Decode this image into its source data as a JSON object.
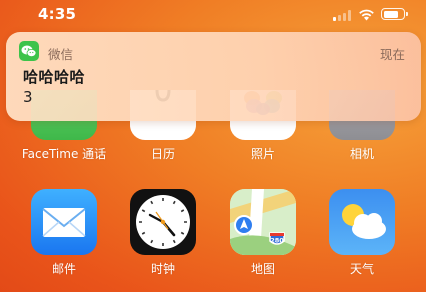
{
  "status_bar": {
    "time": "4:35",
    "signal_icon": "cellular-signal-icon",
    "wifi_icon": "wifi-icon",
    "battery_icon": "battery-icon",
    "battery_level": 0.8
  },
  "notification": {
    "app_name": "微信",
    "time": "现在",
    "title": "哈哈哈哈",
    "body": "3",
    "app_icon": "wechat-icon",
    "accent": "#3dc34a"
  },
  "apps_row1": [
    {
      "label": "FaceTime 通话",
      "icon": "facetime-icon"
    },
    {
      "label": "日历",
      "icon": "calendar-icon"
    },
    {
      "label": "照片",
      "icon": "photos-icon"
    },
    {
      "label": "相机",
      "icon": "camera-icon"
    }
  ],
  "apps_row2": [
    {
      "label": "邮件",
      "icon": "mail-icon"
    },
    {
      "label": "时钟",
      "icon": "clock-icon"
    },
    {
      "label": "地图",
      "icon": "maps-icon",
      "highway_sign": "280"
    },
    {
      "label": "天气",
      "icon": "weather-icon"
    }
  ]
}
